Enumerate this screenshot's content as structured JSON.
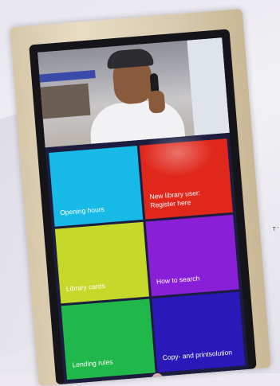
{
  "kiosk": {
    "tiles": [
      {
        "label": "Opening hours",
        "color": "#17b9e6"
      },
      {
        "label": "New library user: Register here",
        "color": "#e0271b"
      },
      {
        "label": "Library cards",
        "color": "#c6d82a"
      },
      {
        "label": "How to search",
        "color": "#8a1fd8"
      },
      {
        "label": "Lending rules",
        "color": "#20b84a"
      },
      {
        "label": "Copy- and printsolution",
        "color": "#2a18b8"
      }
    ],
    "video_call": {
      "icon": "video-call-person"
    },
    "side_label": "T\n'"
  }
}
